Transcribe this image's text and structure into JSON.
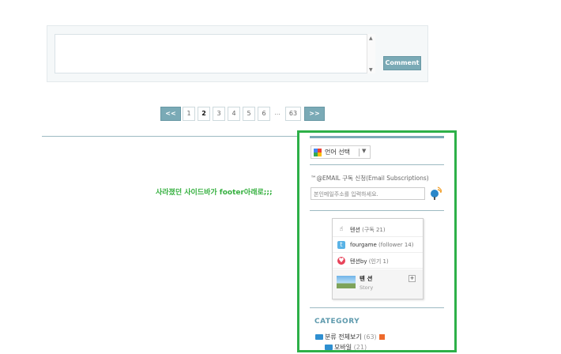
{
  "comment": {
    "submit_label": "Comment"
  },
  "pager": {
    "prev": "<<",
    "pages": [
      "1",
      "2",
      "3",
      "4",
      "5",
      "6"
    ],
    "current": "2",
    "ellipsis": "...",
    "last": "63",
    "next": ">>"
  },
  "note": "사라졌던 사이드바가 footer아래로;;;",
  "sidebar": {
    "language_label": "언어 선택",
    "email": {
      "title": "™@EMAIL 구독 신청(Email Subscriptions)",
      "placeholder": "본인메일주소를 입력하세요."
    },
    "social": {
      "rows": [
        {
          "label": "텐션",
          "count": "(구독 21)"
        },
        {
          "label": "fourgame",
          "count": "(follower 14)"
        },
        {
          "label": "텐션by",
          "count": "(인기 1)"
        }
      ],
      "story_title": "텐 션",
      "story_sub": "Story"
    },
    "category": {
      "title": "CATEGORY",
      "items": [
        {
          "label": "분류 전체보기",
          "count": "(63)"
        },
        {
          "label": "모바일",
          "count": "(21)"
        }
      ]
    }
  },
  "colors": {
    "accent": "#7aaab6",
    "highlight_frame": "#2db048",
    "note_text": "#35b03f"
  }
}
